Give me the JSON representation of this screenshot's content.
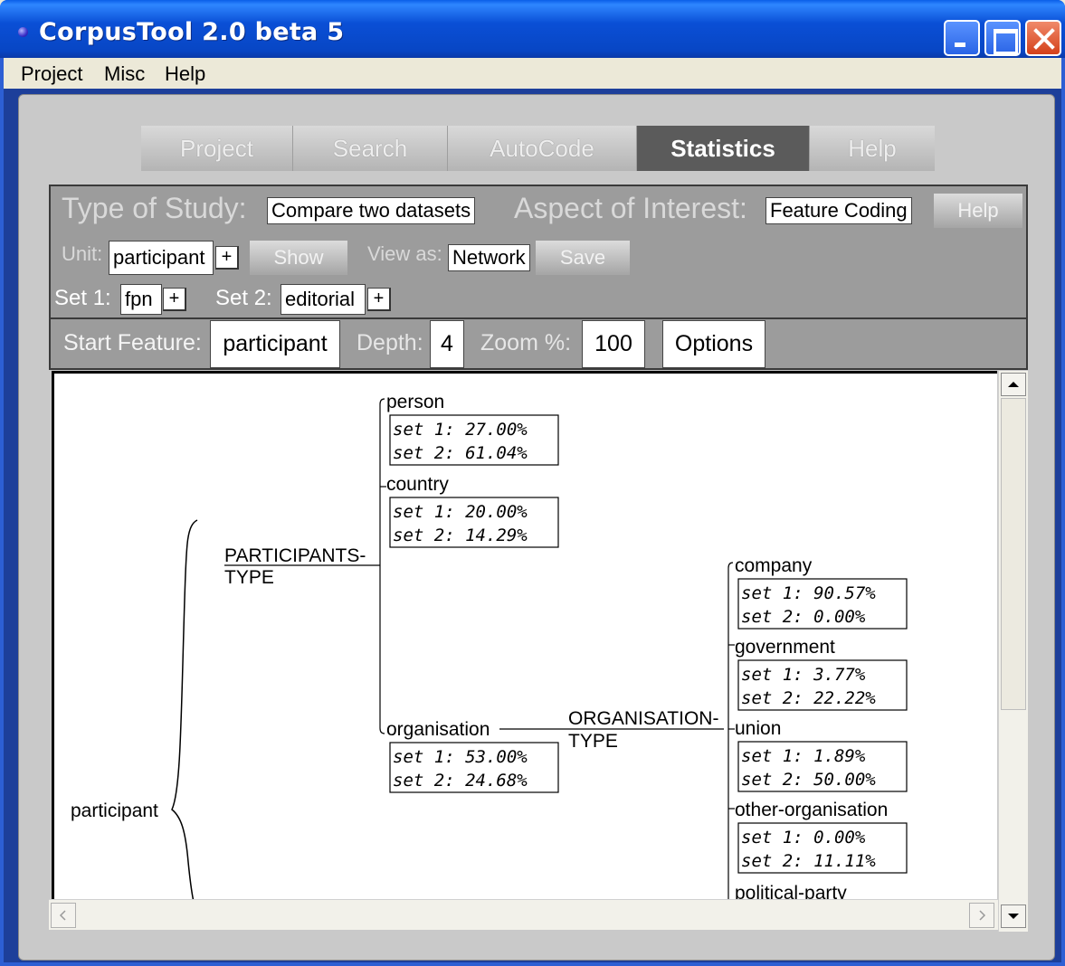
{
  "window": {
    "title": "CorpusTool 2.0 beta 5"
  },
  "menu": [
    "Project",
    "Misc",
    "Help"
  ],
  "tabs": [
    {
      "label": "Project",
      "active": false
    },
    {
      "label": "Search",
      "active": false
    },
    {
      "label": "AutoCode",
      "active": false
    },
    {
      "label": "Statistics",
      "active": true
    },
    {
      "label": "Help",
      "active": false
    }
  ],
  "study": {
    "type_label": "Type of Study:",
    "type_value": "Compare two datasets",
    "aspect_label": "Aspect of Interest:",
    "aspect_value": "Feature Coding",
    "help_label": "Help",
    "unit_label": "Unit:",
    "unit_value": "participant",
    "show_label": "Show",
    "view_label": "View as:",
    "view_value": "Network",
    "save_label": "Save",
    "set1_label": "Set 1:",
    "set1_value": "fpn",
    "set2_label": "Set 2:",
    "set2_value": "editorial",
    "plus": "+"
  },
  "network": {
    "start_label": "Start Feature:",
    "start_value": "participant",
    "depth_label": "Depth:",
    "depth_value": "4",
    "zoom_label": "Zoom %:",
    "zoom_value": "100",
    "options_label": "Options"
  },
  "tree": {
    "root": "participant",
    "system1": [
      "PARTICIPANTS-",
      "TYPE"
    ],
    "system2": [
      "ORGANISATION-",
      "TYPE"
    ],
    "features": {
      "person": {
        "label": "person",
        "set1": "set 1: 27.00%",
        "set2": "set 2: 61.04%"
      },
      "country": {
        "label": "country",
        "set1": "set 1: 20.00%",
        "set2": "set 2: 14.29%"
      },
      "organisation": {
        "label": "organisation",
        "set1": "set 1: 53.00%",
        "set2": "set 2: 24.68%"
      },
      "company": {
        "label": "company",
        "set1": "set 1: 90.57%",
        "set2": "set 2: 0.00%"
      },
      "government": {
        "label": "government",
        "set1": "set 1: 3.77%",
        "set2": "set 2: 22.22%"
      },
      "union": {
        "label": "union",
        "set1": "set 1: 1.89%",
        "set2": "set 2: 50.00%"
      },
      "other_organisation": {
        "label": "other-organisation",
        "set1": "set 1: 0.00%",
        "set2": "set 2: 11.11%"
      },
      "political_party": {
        "label": "political-party"
      }
    }
  }
}
